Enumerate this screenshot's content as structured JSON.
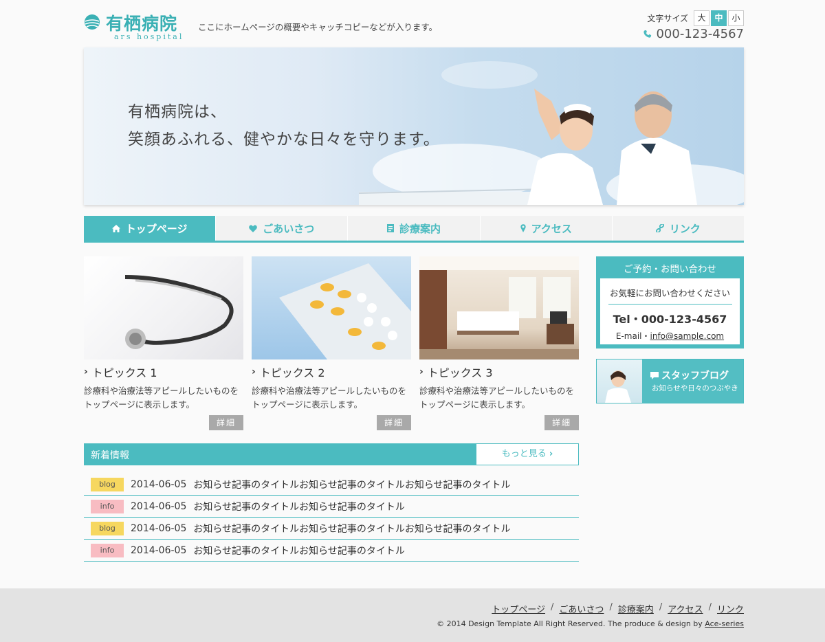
{
  "header": {
    "logo_title": "有栖病院",
    "logo_sub": "ars hospital",
    "tagline": "ここにホームページの概要やキャッチコピーなどが入ります。",
    "font_size_label": "文字サイズ",
    "font_sizes": [
      {
        "label": "大",
        "active": false
      },
      {
        "label": "中",
        "active": true
      },
      {
        "label": "小",
        "active": false
      }
    ],
    "phone": "000-123-4567",
    "phone_icon": "phone-icon"
  },
  "hero": {
    "line1": "有栖病院は、",
    "line2": "笑顔あふれる、健やかな日々を守ります。"
  },
  "nav": {
    "items": [
      {
        "label": "トップページ",
        "icon": "home-icon",
        "active": true
      },
      {
        "label": "ごあいさつ",
        "icon": "heart-icon",
        "active": false
      },
      {
        "label": "診療案内",
        "icon": "document-icon",
        "active": false
      },
      {
        "label": "アクセス",
        "icon": "map-pin-icon",
        "active": false
      },
      {
        "label": "リンク",
        "icon": "link-icon",
        "active": false
      }
    ]
  },
  "topics": [
    {
      "title": "トピックス 1",
      "text": "診療科や治療法等アピールしたいものをトップページに表示します。",
      "more": "詳細",
      "image": "stethoscope"
    },
    {
      "title": "トピックス 2",
      "text": "診療科や治療法等アピールしたいものをトップページに表示します。",
      "more": "詳細",
      "image": "pills"
    },
    {
      "title": "トピックス 3",
      "text": "診療科や治療法等アピールしたいものをトップページに表示します。",
      "more": "詳細",
      "image": "hospital-room"
    }
  ],
  "news": {
    "title": "新着情報",
    "more": "もっと見る",
    "items": [
      {
        "category": "blog",
        "date": "2014-06-05",
        "title": "お知らせ記事のタイトルお知らせ記事のタイトルお知らせ記事のタイトル"
      },
      {
        "category": "info",
        "date": "2014-06-05",
        "title": "お知らせ記事のタイトルお知らせ記事のタイトル"
      },
      {
        "category": "blog",
        "date": "2014-06-05",
        "title": "お知らせ記事のタイトルお知らせ記事のタイトルお知らせ記事のタイトル"
      },
      {
        "category": "info",
        "date": "2014-06-05",
        "title": "お知らせ記事のタイトルお知らせ記事のタイトル"
      }
    ]
  },
  "sidebar": {
    "contact": {
      "heading": "ご予約・お問い合わせ",
      "message": "お気軽にお問い合わせください",
      "tel": "Tel・000-123-4567",
      "email_label": "E-mail・",
      "email": "info@sample.com"
    },
    "blog": {
      "title": "スタッフブログ",
      "subtitle": "お知らせや日々のつぶやき"
    }
  },
  "footer": {
    "links": [
      "トップページ",
      "ごあいさつ",
      "診療案内",
      "アクセス",
      "リンク"
    ],
    "copyright": "© 2014 Design Template All Right Reserved. The produce & design by ",
    "credit": "Ace-series"
  },
  "colors": {
    "accent": "#4bbbc0",
    "blog_badge": "#f6d75f",
    "info_badge": "#f8bcc2",
    "button_gray": "#a9a9a9"
  }
}
